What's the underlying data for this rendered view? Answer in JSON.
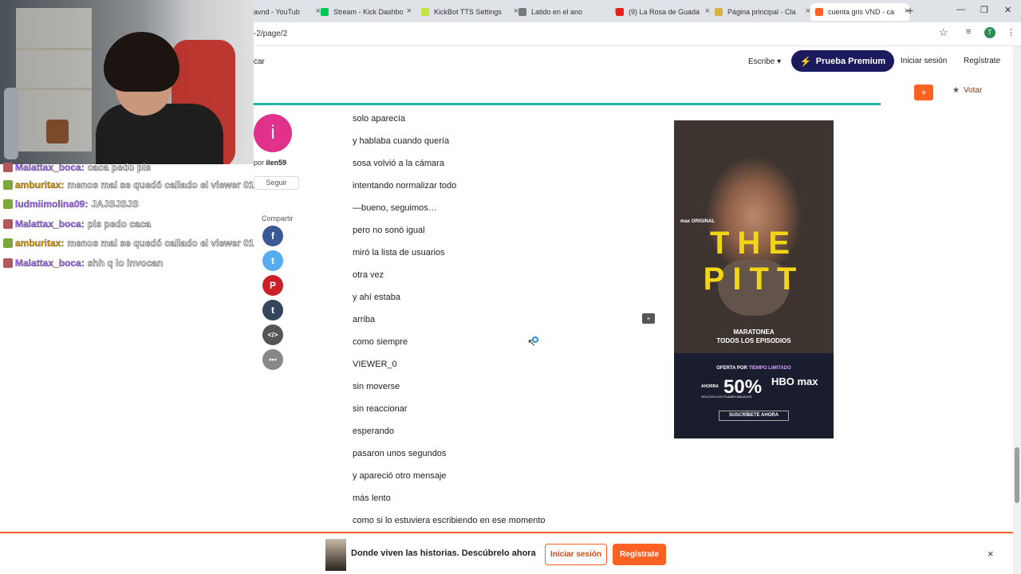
{
  "browser": {
    "tabs": [
      {
        "title": "avnd - YouTub",
        "favicon_color": "#ffffff",
        "close": "×"
      },
      {
        "title": "Stream - Kick Dashbo",
        "favicon_color": "#00c853",
        "close": "×"
      },
      {
        "title": "KickBot TTS Settings",
        "favicon_color": "#c6e33c",
        "close": "×"
      },
      {
        "title": "Latido en el ano",
        "favicon_color": "#7a7a7a",
        "close": "×"
      },
      {
        "title": "(9) La Rosa de Guada",
        "favicon_color": "#e62117",
        "close": "×"
      },
      {
        "title": "Página principal - Cla",
        "favicon_color": "#d4b43a",
        "close": "×"
      },
      {
        "title": "cuenta gris VND - ca",
        "favicon_color": "#ff6122",
        "close": "×"
      }
    ],
    "new_tab": "+",
    "window_controls": [
      "—",
      "❐",
      "✕"
    ],
    "url": "-2/page/2",
    "star": "☆",
    "profile_initial": "T"
  },
  "header": {
    "search_fragment": "car",
    "write_label": "Escribe ▾",
    "premium_label": "Prueba Premium",
    "login_label": "Iniciar sesión",
    "signup_label": "Regístrate"
  },
  "story_bar": {
    "add_label": "+",
    "vote_label": "Votar",
    "accent_color": "#ff6122",
    "progress_color": "#1fb5a5"
  },
  "author": {
    "initial": "i",
    "by_prefix": "por",
    "name": "ilen59",
    "follow_label": "Seguir",
    "avatar_color": "#e0328a"
  },
  "share": {
    "label": "Compartir",
    "buttons": [
      {
        "name": "facebook-share-button",
        "glyph": "f",
        "color": "#3b5998"
      },
      {
        "name": "twitter-share-button",
        "glyph": "t",
        "color": "#55acee"
      },
      {
        "name": "pinterest-share-button",
        "glyph": "P",
        "color": "#cb2027"
      },
      {
        "name": "tumblr-share-button",
        "glyph": "t",
        "color": "#35465c"
      },
      {
        "name": "embed-share-button",
        "glyph": "</>",
        "color": "#555555"
      },
      {
        "name": "more-share-button",
        "glyph": "•••",
        "color": "#888888"
      }
    ]
  },
  "story": {
    "lines": [
      "solo aparecía",
      "y hablaba cuando quería",
      "sosa volvió a la cámara",
      "intentando normalizar todo",
      "—bueno, seguimos…",
      "pero no sonó igual",
      "miró la lista de usuarios",
      "otra vez",
      "y ahí estaba",
      "arriba",
      "como siempre",
      "VIEWER_0",
      "sin moverse",
      "sin reaccionar",
      "esperando",
      "pasaron unos segundos",
      "y apareció otro mensaje",
      "más lento",
      "como si lo estuviera escribiendo en ese momento"
    ],
    "comment_glyph": "+"
  },
  "ad": {
    "network": "max ORIGINAL",
    "title": "THE PITT",
    "tagline_1": "MARATONEA",
    "tagline_2": "TODOS LOS EPISODIOS",
    "offer_prefix": "OFERTA POR",
    "offer_highlight": "TIEMPO LIMITADO",
    "save_word": "AHORRA",
    "percent": "50%",
    "brand": "HBO max",
    "plans_note": "SOLO EN LOS PLANES ANUALES",
    "cta": "SUSCRÍBETE AHORA"
  },
  "bottom_bar": {
    "text": "Donde viven las historias. Descúbrelo ahora",
    "login_label": "Iniciar sesión",
    "signup_label": "Regístrate",
    "close": "×"
  },
  "chat": {
    "messages": [
      {
        "user": "Malattax_boca:",
        "text": "caca pedo pis",
        "badge_color": "#b0585e",
        "user_color": "#a86cff"
      },
      {
        "user": "amburitax:",
        "text": "menos mal se quedó callado el viewer 01",
        "badge_color": "#7aa83a",
        "user_color": "#e5a100"
      },
      {
        "user": "ludmiimolina09:",
        "text": "JAJSJSJS",
        "badge_color": "#7aa83a",
        "user_color": "#a86cff"
      },
      {
        "user": "Malattax_boca:",
        "text": "pis pedo caca",
        "badge_color": "#b0585e",
        "user_color": "#a86cff"
      },
      {
        "user": "amburitax:",
        "text": "menos mal se quedó callado el viewer 01",
        "badge_color": "#7aa83a",
        "user_color": "#e5a100"
      },
      {
        "user": "Malattax_boca:",
        "text": "shh q lo invocan",
        "badge_color": "#b0585e",
        "user_color": "#a86cff"
      }
    ]
  }
}
